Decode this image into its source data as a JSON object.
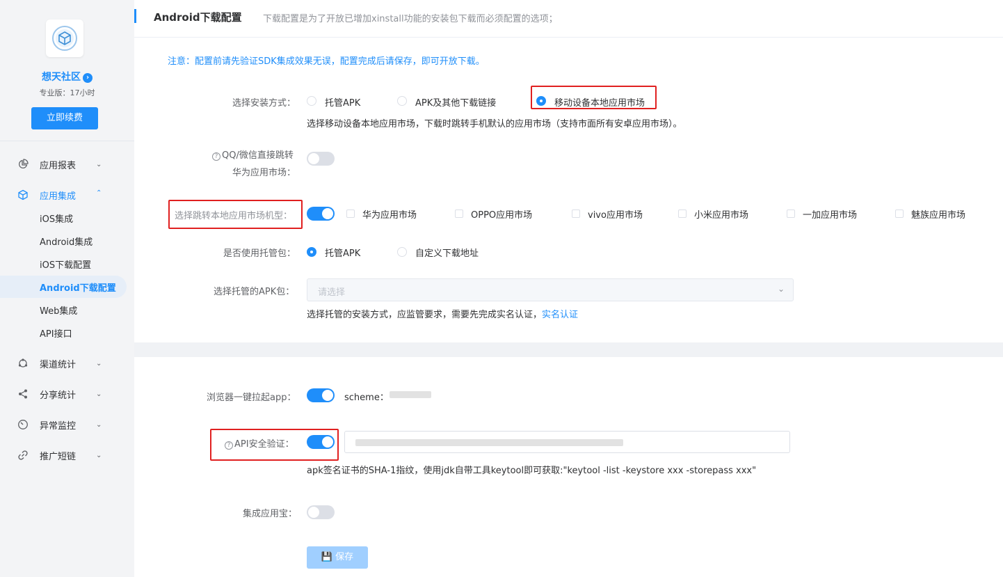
{
  "sidebar": {
    "app_name": "想天社区",
    "plan": "专业版：17小时",
    "renew_label": "立即续费",
    "menu": {
      "reports": "应用报表",
      "integration": "应用集成",
      "channel": "渠道统计",
      "share": "分享统计",
      "monitor": "异常监控",
      "shortlink": "推广短链"
    },
    "submenu": {
      "ios": "iOS集成",
      "android": "Android集成",
      "ios_download": "iOS下载配置",
      "android_download": "Android下载配置",
      "web": "Web集成",
      "api": "API接口"
    }
  },
  "header": {
    "title": "Android下载配置",
    "desc": "下载配置是为了开放已增加xinstall功能的安装包下载而必须配置的选项；"
  },
  "form": {
    "notice": "注意：配置前请先验证SDK集成效果无误，配置完成后请保存，即可开放下载。",
    "install_label": "选择安装方式：",
    "install_options": [
      "托管APK",
      "APK及其他下载链接",
      "移动设备本地应用市场"
    ],
    "install_hint": "选择移动设备本地应用市场，下载时跳转手机默认的应用市场（支持市面所有安卓应用市场）。",
    "qq_label_line1": "QQ/微信直接跳转",
    "qq_label_line2": "华为应用市场：",
    "market_label": "选择跳转本地应用市场机型：",
    "markets": [
      "华为应用市场",
      "OPPO应用市场",
      "vivo应用市场",
      "小米应用市场",
      "一加应用市场",
      "魅族应用市场"
    ],
    "hosted_label": "是否使用托管包：",
    "hosted_options": [
      "托管APK",
      "自定义下载地址"
    ],
    "apk_label": "选择托管的APK包：",
    "apk_placeholder": "请选择",
    "apk_hint": "选择托管的安装方式，应监管要求，需要先完成实名认证，",
    "apk_hint_link": "实名认证",
    "browser_label": "浏览器一键拉起app：",
    "scheme_label": "scheme：",
    "api_label": "API安全验证：",
    "sha_hint": "apk签名证书的SHA-1指纹，使用jdk自带工具keytool即可获取:\"keytool -list -keystore xxx -storepass xxx\"",
    "yyb_label": "集成应用宝：",
    "save_label": "保存"
  },
  "colors": {
    "accent": "#1f8efa",
    "highlight_box": "#e02020"
  }
}
